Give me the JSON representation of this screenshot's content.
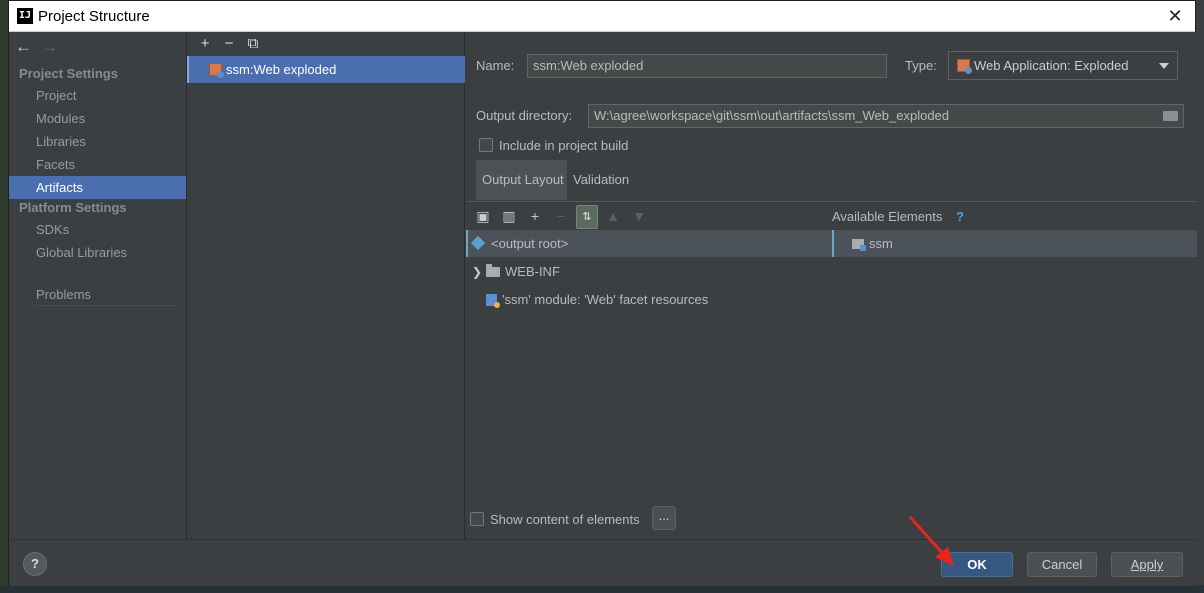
{
  "window": {
    "title": "Project Structure",
    "app_icon": "IJ",
    "close_glyph": "✕"
  },
  "nav": {
    "back_glyph": "←",
    "forward_glyph": "→",
    "sections": [
      {
        "label": "Project Settings",
        "items": [
          "Project",
          "Modules",
          "Libraries",
          "Facets",
          "Artifacts"
        ]
      },
      {
        "label": "Platform Settings",
        "items": [
          "SDKs",
          "Global Libraries"
        ]
      }
    ],
    "extra_items": [
      "Problems"
    ],
    "selected": "Artifacts"
  },
  "artifacts": {
    "toolbar": {
      "add": "+",
      "remove": "−",
      "copy": "⧉"
    },
    "items": [
      "ssm:Web exploded"
    ]
  },
  "detail": {
    "name_label": "Name:",
    "name_value": "ssm:Web exploded",
    "type_label": "Type:",
    "type_value": "Web Application: Exploded",
    "output_dir_label": "Output directory:",
    "output_dir_value": "W:\\agree\\workspace\\git\\ssm\\out\\artifacts\\ssm_Web_exploded",
    "include_build_label": "Include in project build",
    "tabs": [
      "Output Layout",
      "Validation"
    ],
    "available_elements_label": "Available Elements",
    "help_glyph": "?",
    "layout_tree": [
      {
        "label": "<output root>"
      },
      {
        "label": "WEB-INF"
      },
      {
        "label": "'ssm' module: 'Web' facet resources"
      }
    ],
    "available_tree": [
      "ssm"
    ],
    "show_content_label": "Show content of elements",
    "more_button": "..."
  },
  "footer": {
    "help": "?",
    "ok": "OK",
    "cancel": "Cancel",
    "apply": "Apply",
    "annotation_color": "#e8241e"
  }
}
